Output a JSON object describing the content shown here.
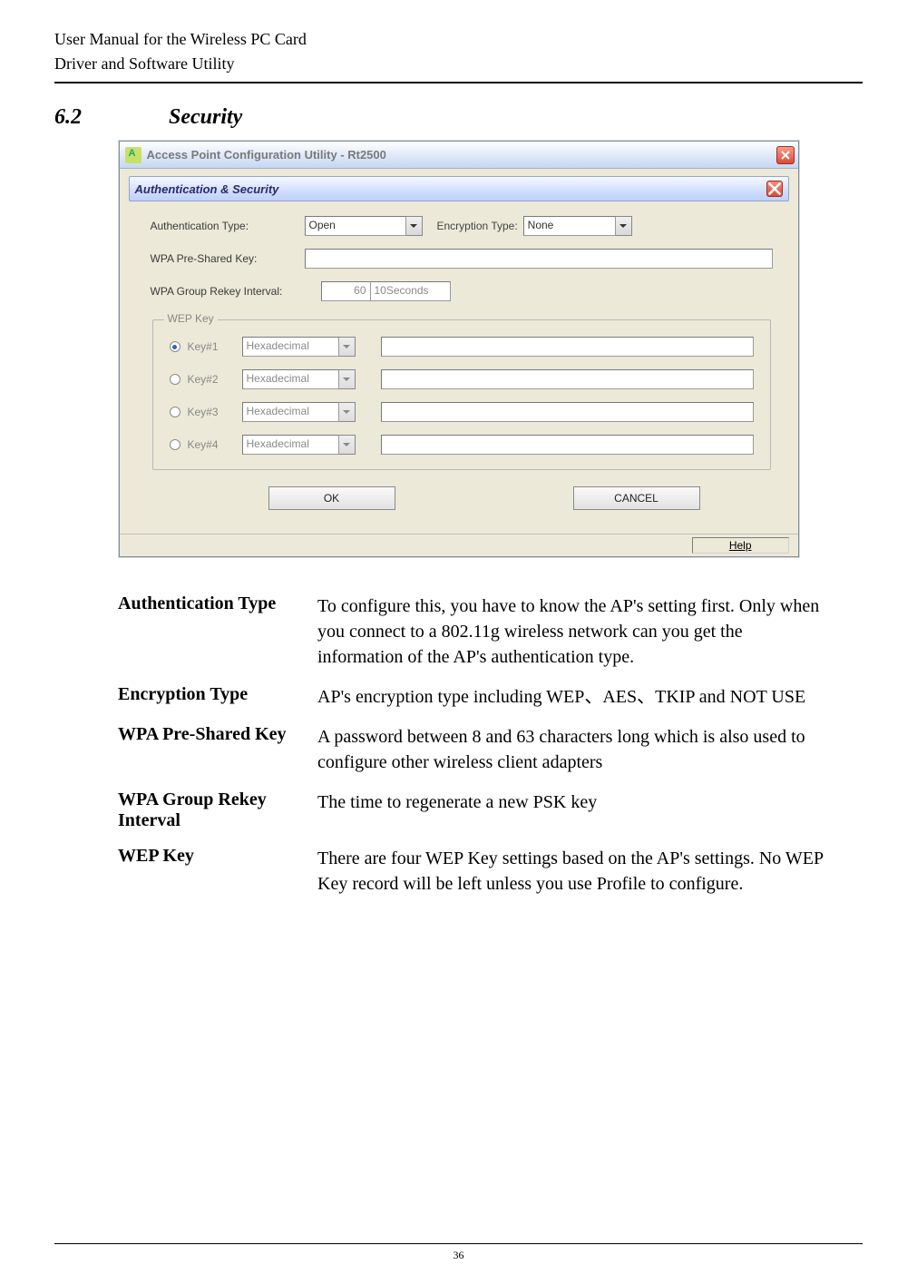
{
  "header": {
    "line1": "User Manual for the Wireless PC Card",
    "line2": "Driver and Software Utility"
  },
  "section": {
    "number": "6.2",
    "title": "Security"
  },
  "window": {
    "title": "Access Point Configuration Utility - Rt2500",
    "section_title": "Authentication & Security",
    "labels": {
      "auth_type": "Authentication Type:",
      "enc_type": "Encryption Type:",
      "psk": "WPA Pre-Shared Key:",
      "interval": "WPA Group Rekey Interval:"
    },
    "values": {
      "auth_type": "Open",
      "enc_type": "None",
      "psk": "",
      "interval": "60",
      "interval_unit": "10Seconds"
    },
    "wep": {
      "legend": "WEP Key",
      "keys": [
        {
          "label": "Key#1",
          "format": "Hexadecimal",
          "selected": true,
          "value": ""
        },
        {
          "label": "Key#2",
          "format": "Hexadecimal",
          "selected": false,
          "value": ""
        },
        {
          "label": "Key#3",
          "format": "Hexadecimal",
          "selected": false,
          "value": ""
        },
        {
          "label": "Key#4",
          "format": "Hexadecimal",
          "selected": false,
          "value": ""
        }
      ]
    },
    "buttons": {
      "ok": "OK",
      "cancel": "CANCEL"
    },
    "statusbar": "Help"
  },
  "definitions": [
    {
      "term": "Authentication Type",
      "desc": "To configure this, you have to know the AP's setting first. Only when you connect to a 802.11g wireless network can you get the information of the AP's authentication type."
    },
    {
      "term": "Encryption Type",
      "desc": "AP's encryption type including WEP、AES、TKIP and NOT USE"
    },
    {
      "term": "WPA Pre-Shared Key",
      "desc": "A password between 8 and 63 characters long which is also used to configure other wireless client adapters"
    },
    {
      "term": "WPA Group Rekey Interval",
      "desc": "The time to regenerate a new PSK key"
    },
    {
      "term": "WEP Key",
      "desc": "There are four WEP Key settings based on the AP's settings. No WEP Key record will be left unless you use Profile to configure."
    }
  ],
  "page_number": "36"
}
